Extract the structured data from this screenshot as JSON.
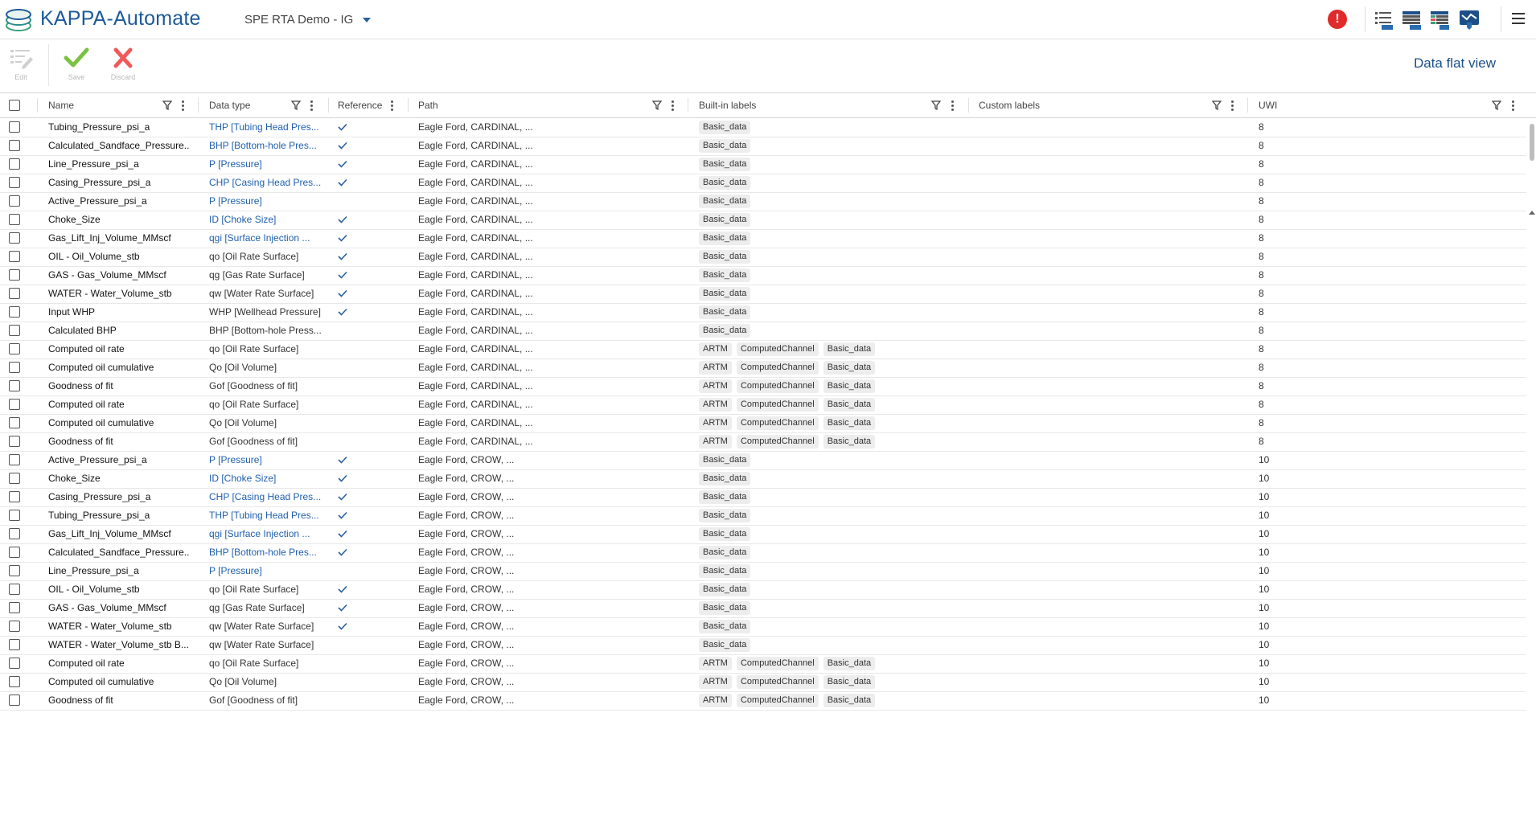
{
  "header": {
    "brand": "KAPPA-Automate",
    "project": "SPE RTA Demo - IG",
    "alert_symbol": "!",
    "icons": [
      "list-view-icon",
      "table-view-icon",
      "grid-view-icon",
      "data-shield-icon"
    ]
  },
  "toolbar": {
    "edit_label": "Edit",
    "save_label": "Save",
    "discard_label": "Discard",
    "view_title": "Data flat view"
  },
  "table": {
    "columns": {
      "name": "Name",
      "data_type": "Data type",
      "reference": "Reference",
      "path": "Path",
      "builtin_labels": "Built-in labels",
      "custom_labels": "Custom labels",
      "uwi": "UWI"
    },
    "rows": [
      {
        "name": "Tubing_Pressure_psi_a",
        "type": "THP [Tubing Head Pres...",
        "ref": true,
        "path": "Eagle Ford, CARDINAL, ...",
        "labels": [
          "Basic_data"
        ],
        "uwi": "8"
      },
      {
        "name": "Calculated_Sandface_Pressure...",
        "type": "BHP [Bottom-hole Pres...",
        "ref": true,
        "path": "Eagle Ford, CARDINAL, ...",
        "labels": [
          "Basic_data"
        ],
        "uwi": "8"
      },
      {
        "name": "Line_Pressure_psi_a",
        "type": "P [Pressure]",
        "ref": true,
        "path": "Eagle Ford, CARDINAL, ...",
        "labels": [
          "Basic_data"
        ],
        "uwi": "8"
      },
      {
        "name": "Casing_Pressure_psi_a",
        "type": "CHP [Casing Head Pres...",
        "ref": true,
        "path": "Eagle Ford, CARDINAL, ...",
        "labels": [
          "Basic_data"
        ],
        "uwi": "8"
      },
      {
        "name": "Active_Pressure_psi_a",
        "type": "P [Pressure]",
        "ref": false,
        "typeRef": true,
        "path": "Eagle Ford, CARDINAL, ...",
        "labels": [
          "Basic_data"
        ],
        "uwi": "8"
      },
      {
        "name": "Choke_Size",
        "type": "ID [Choke Size]",
        "ref": true,
        "path": "Eagle Ford, CARDINAL, ...",
        "labels": [
          "Basic_data"
        ],
        "uwi": "8"
      },
      {
        "name": "Gas_Lift_Inj_Volume_MMscf",
        "type": "qgi [Surface Injection ...",
        "ref": true,
        "path": "Eagle Ford, CARDINAL, ...",
        "labels": [
          "Basic_data"
        ],
        "uwi": "8"
      },
      {
        "name": "OIL - Oil_Volume_stb",
        "type": "qo [Oil Rate Surface]",
        "ref": true,
        "typeRef": false,
        "path": "Eagle Ford, CARDINAL, ...",
        "labels": [
          "Basic_data"
        ],
        "uwi": "8"
      },
      {
        "name": "GAS - Gas_Volume_MMscf",
        "type": "qg [Gas Rate Surface]",
        "ref": true,
        "typeRef": false,
        "path": "Eagle Ford, CARDINAL, ...",
        "labels": [
          "Basic_data"
        ],
        "uwi": "8"
      },
      {
        "name": "WATER - Water_Volume_stb",
        "type": "qw [Water Rate Surface]",
        "ref": true,
        "typeRef": false,
        "path": "Eagle Ford, CARDINAL, ...",
        "labels": [
          "Basic_data"
        ],
        "uwi": "8"
      },
      {
        "name": "Input WHP",
        "type": "WHP [Wellhead Pressure]",
        "ref": true,
        "typeRef": false,
        "path": "Eagle Ford, CARDINAL, ...",
        "labels": [
          "Basic_data"
        ],
        "uwi": "8"
      },
      {
        "name": "Calculated BHP",
        "type": "BHP [Bottom-hole Press...",
        "ref": false,
        "typeRef": false,
        "path": "Eagle Ford, CARDINAL, ...",
        "labels": [
          "Basic_data"
        ],
        "uwi": "8"
      },
      {
        "name": "Computed oil rate",
        "type": "qo [Oil Rate Surface]",
        "ref": false,
        "typeRef": false,
        "path": "Eagle Ford, CARDINAL, ...",
        "labels": [
          "ARTM",
          "ComputedChannel",
          "Basic_data"
        ],
        "uwi": "8"
      },
      {
        "name": "Computed oil cumulative",
        "type": "Qo [Oil Volume]",
        "ref": false,
        "typeRef": false,
        "path": "Eagle Ford, CARDINAL, ...",
        "labels": [
          "ARTM",
          "ComputedChannel",
          "Basic_data"
        ],
        "uwi": "8"
      },
      {
        "name": "Goodness of fit",
        "type": "Gof [Goodness of fit]",
        "ref": false,
        "typeRef": false,
        "path": "Eagle Ford, CARDINAL, ...",
        "labels": [
          "ARTM",
          "ComputedChannel",
          "Basic_data"
        ],
        "uwi": "8"
      },
      {
        "name": "Computed oil rate",
        "type": "qo [Oil Rate Surface]",
        "ref": false,
        "typeRef": false,
        "path": "Eagle Ford, CARDINAL, ...",
        "labels": [
          "ARTM",
          "ComputedChannel",
          "Basic_data"
        ],
        "uwi": "8"
      },
      {
        "name": "Computed oil cumulative",
        "type": "Qo [Oil Volume]",
        "ref": false,
        "typeRef": false,
        "path": "Eagle Ford, CARDINAL, ...",
        "labels": [
          "ARTM",
          "ComputedChannel",
          "Basic_data"
        ],
        "uwi": "8"
      },
      {
        "name": "Goodness of fit",
        "type": "Gof [Goodness of fit]",
        "ref": false,
        "typeRef": false,
        "path": "Eagle Ford, CARDINAL, ...",
        "labels": [
          "ARTM",
          "ComputedChannel",
          "Basic_data"
        ],
        "uwi": "8"
      },
      {
        "name": "Active_Pressure_psi_a",
        "type": "P [Pressure]",
        "ref": true,
        "path": "Eagle Ford, CROW, ...",
        "labels": [
          "Basic_data"
        ],
        "uwi": "10"
      },
      {
        "name": "Choke_Size",
        "type": "ID [Choke Size]",
        "ref": true,
        "path": "Eagle Ford, CROW, ...",
        "labels": [
          "Basic_data"
        ],
        "uwi": "10"
      },
      {
        "name": "Casing_Pressure_psi_a",
        "type": "CHP [Casing Head Pres...",
        "ref": true,
        "path": "Eagle Ford, CROW, ...",
        "labels": [
          "Basic_data"
        ],
        "uwi": "10"
      },
      {
        "name": "Tubing_Pressure_psi_a",
        "type": "THP [Tubing Head Pres...",
        "ref": true,
        "path": "Eagle Ford, CROW, ...",
        "labels": [
          "Basic_data"
        ],
        "uwi": "10"
      },
      {
        "name": "Gas_Lift_Inj_Volume_MMscf",
        "type": "qgi [Surface Injection ...",
        "ref": true,
        "path": "Eagle Ford, CROW, ...",
        "labels": [
          "Basic_data"
        ],
        "uwi": "10"
      },
      {
        "name": "Calculated_Sandface_Pressure...",
        "type": "BHP [Bottom-hole Pres...",
        "ref": true,
        "path": "Eagle Ford, CROW, ...",
        "labels": [
          "Basic_data"
        ],
        "uwi": "10"
      },
      {
        "name": "Line_Pressure_psi_a",
        "type": "P [Pressure]",
        "ref": false,
        "typeRef": true,
        "path": "Eagle Ford, CROW, ...",
        "labels": [
          "Basic_data"
        ],
        "uwi": "10"
      },
      {
        "name": "OIL - Oil_Volume_stb",
        "type": "qo [Oil Rate Surface]",
        "ref": true,
        "typeRef": false,
        "path": "Eagle Ford, CROW, ...",
        "labels": [
          "Basic_data"
        ],
        "uwi": "10"
      },
      {
        "name": "GAS - Gas_Volume_MMscf",
        "type": "qg [Gas Rate Surface]",
        "ref": true,
        "typeRef": false,
        "path": "Eagle Ford, CROW, ...",
        "labels": [
          "Basic_data"
        ],
        "uwi": "10"
      },
      {
        "name": "WATER - Water_Volume_stb",
        "type": "qw [Water Rate Surface]",
        "ref": true,
        "typeRef": false,
        "path": "Eagle Ford, CROW, ...",
        "labels": [
          "Basic_data"
        ],
        "uwi": "10"
      },
      {
        "name": "WATER - Water_Volume_stb B...",
        "type": "qw [Water Rate Surface]",
        "ref": false,
        "typeRef": false,
        "path": "Eagle Ford, CROW, ...",
        "labels": [
          "Basic_data"
        ],
        "uwi": "10"
      },
      {
        "name": "Computed oil rate",
        "type": "qo [Oil Rate Surface]",
        "ref": false,
        "typeRef": false,
        "path": "Eagle Ford, CROW, ...",
        "labels": [
          "ARTM",
          "ComputedChannel",
          "Basic_data"
        ],
        "uwi": "10"
      },
      {
        "name": "Computed oil cumulative",
        "type": "Qo [Oil Volume]",
        "ref": false,
        "typeRef": false,
        "path": "Eagle Ford, CROW, ...",
        "labels": [
          "ARTM",
          "ComputedChannel",
          "Basic_data"
        ],
        "uwi": "10"
      },
      {
        "name": "Goodness of fit",
        "type": "Gof [Goodness of fit]",
        "ref": false,
        "typeRef": false,
        "path": "Eagle Ford, CROW, ...",
        "labels": [
          "ARTM",
          "ComputedChannel",
          "Basic_data"
        ],
        "uwi": "10"
      }
    ]
  },
  "colors": {
    "brand": "#1c5a9a",
    "link": "#1f5fae",
    "alert": "#e02b2b",
    "save_green": "#7cc242",
    "discard_red": "#f05a5a"
  }
}
